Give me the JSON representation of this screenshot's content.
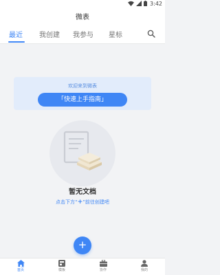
{
  "status_bar": {
    "time": "3:42"
  },
  "header": {
    "title": "微表"
  },
  "tabs": [
    {
      "label": "最近",
      "active": true
    },
    {
      "label": "我创建",
      "active": false
    },
    {
      "label": "我参与",
      "active": false
    },
    {
      "label": "星标",
      "active": false
    }
  ],
  "welcome": {
    "text": "欢迎来到微表",
    "guide_button": "「快速上手指南」"
  },
  "empty_state": {
    "title": "暂无文档",
    "hint_prefix": "点击下方“",
    "hint_plus": "+",
    "hint_suffix": "”前往创建吧"
  },
  "fab": {
    "icon": "plus-icon",
    "label": "+"
  },
  "bottom_nav": [
    {
      "label": "首页",
      "icon": "home-icon",
      "active": true
    },
    {
      "label": "模板",
      "icon": "template-icon",
      "active": false
    },
    {
      "label": "协作",
      "icon": "briefcase-icon",
      "active": false
    },
    {
      "label": "我的",
      "icon": "person-icon",
      "active": false
    }
  ],
  "colors": {
    "accent": "#3f86f5",
    "background": "#f2f3f5",
    "welcome_bg": "#e2ecfb"
  }
}
